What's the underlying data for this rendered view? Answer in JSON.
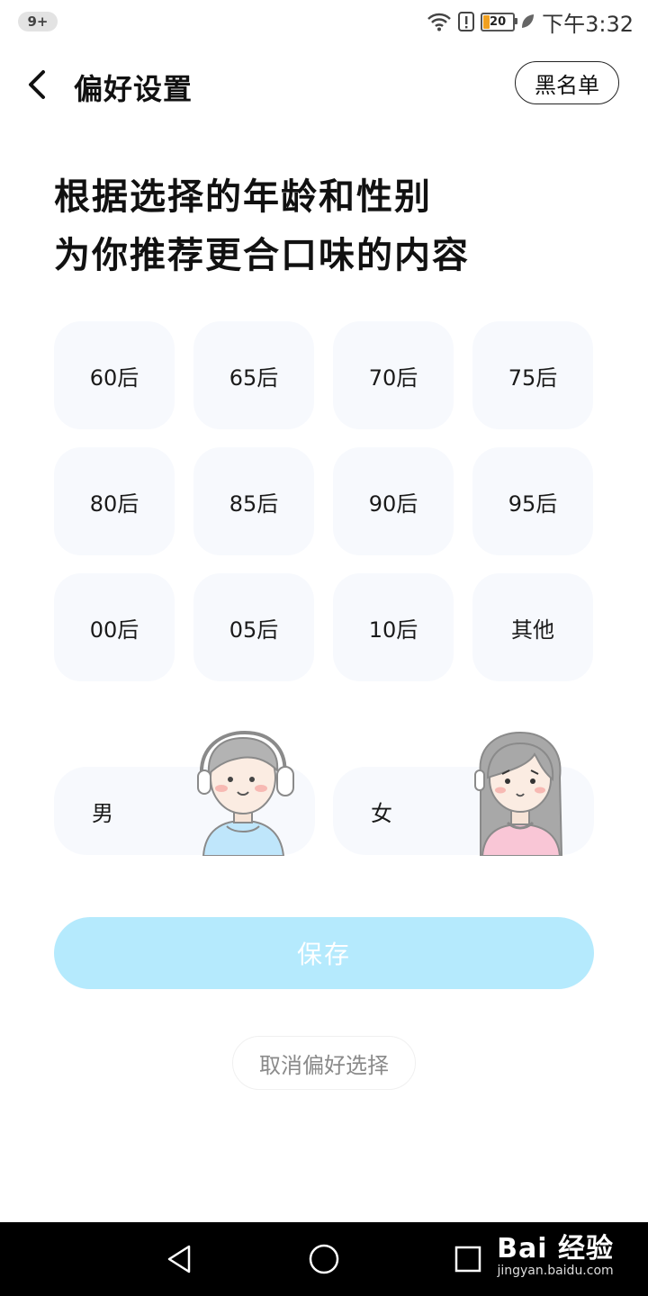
{
  "status_bar": {
    "notification_count": "9+",
    "battery_level": "20",
    "time": "下午3:32",
    "icons": [
      "wifi-icon",
      "alert-icon",
      "battery-icon",
      "leaf-icon"
    ]
  },
  "header": {
    "back_icon": "chevron-left-icon",
    "title": "偏好设置",
    "blacklist_label": "黑名单"
  },
  "headline": {
    "line1": "根据选择的年龄和性别",
    "line2": "为你推荐更合口味的内容"
  },
  "age_options": [
    "60后",
    "65后",
    "70后",
    "75后",
    "80后",
    "85后",
    "90后",
    "95后",
    "00后",
    "05后",
    "10后",
    "其他"
  ],
  "gender_options": {
    "male": "男",
    "female": "女"
  },
  "actions": {
    "save_label": "保存",
    "cancel_label": "取消偏好选择"
  },
  "nav_bar": {
    "icons": [
      "back-triangle-icon",
      "home-circle-icon",
      "recents-square-icon"
    ]
  },
  "watermark": {
    "main": "Bai 经验",
    "sub": "jingyan.baidu.com"
  },
  "colors": {
    "save_button": "#b5eafd",
    "tile_background": "#f7f9fd",
    "male_shirt": "#bfe6fb",
    "female_shirt": "#f9c6d6"
  }
}
